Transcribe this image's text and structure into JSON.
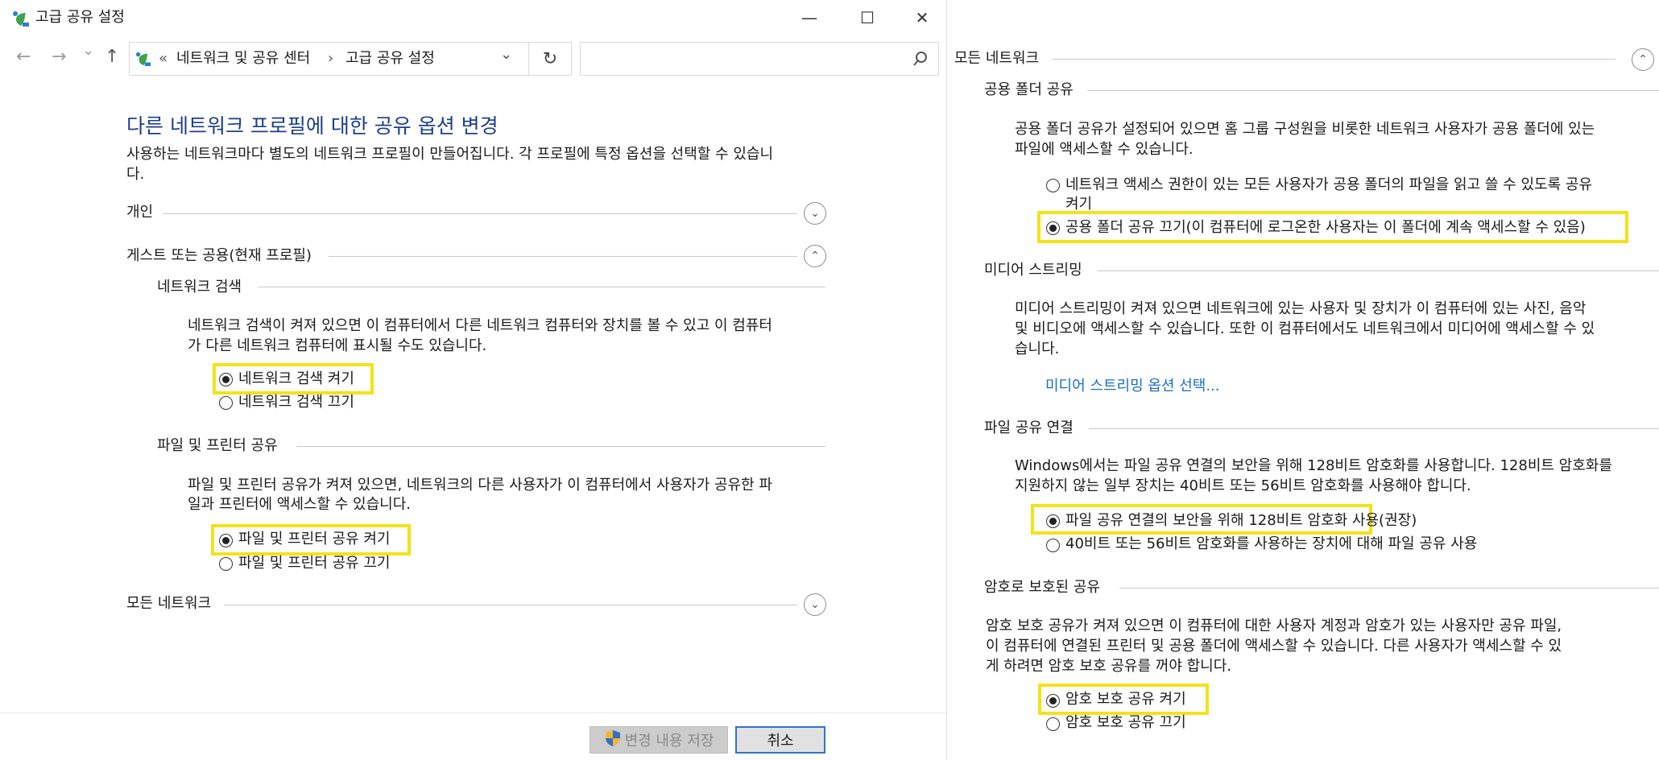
{
  "window": {
    "title": "고급 공유 설정",
    "minimize_glyph": "—",
    "maximize_glyph": "☐",
    "close_glyph": "✕"
  },
  "nav": {
    "back_glyph": "←",
    "forward_glyph": "→",
    "dropdown_glyph": "⌄",
    "up_glyph": "↑"
  },
  "address": {
    "prefix": "«",
    "crumb1": "네트워크 및 공유 센터",
    "separator": "›",
    "crumb2": "고급 공유 설정",
    "dropdown_glyph": "⌄",
    "refresh_glyph": "↻",
    "search_value": "",
    "search_icon": "🔍"
  },
  "left": {
    "heading": "다른 네트워크 프로필에 대한 공유 옵션 변경",
    "intro_line1": "사용하는 네트워크마다 별도의 네트워크 프로필이 만들어집니다. 각 프로필에 특정 옵션을 선택할 수 있습니",
    "intro_line2": "다.",
    "private_label": "개인",
    "guest_label": "게스트 또는 공용(현재 프로필)",
    "netdisc": {
      "title": "네트워크 검색",
      "desc1": "네트워크 검색이 켜져 있으면 이 컴퓨터에서 다른 네트워크 컴퓨터와 장치를 볼 수 있고 이 컴퓨터",
      "desc2": "가 다른 네트워크 컴퓨터에 표시될 수도 있습니다.",
      "on": "네트워크 검색 켜기",
      "off": "네트워크 검색 끄기"
    },
    "fps": {
      "title": "파일 및 프린터 공유",
      "desc1": "파일 및 프린터 공유가 켜져 있으면, 네트워크의 다른 사용자가 이 컴퓨터에서 사용자가 공유한 파",
      "desc2": "일과 프린터에 액세스할 수 있습니다.",
      "on": "파일 및 프린터 공유 켜기",
      "off": "파일 및 프린터 공유 끄기"
    },
    "all_networks_label": "모든 네트워크"
  },
  "buttons": {
    "save": "변경 내용 저장",
    "cancel": "취소"
  },
  "right": {
    "all_networks_label": "모든 네트워크",
    "public_folder": {
      "title": "공용 폴더 공유",
      "desc1": "공용 폴더 공유가 설정되어 있으면 홈 그룹 구성원을 비롯한 네트워크 사용자가 공용 폴더에 있는",
      "desc2": "파일에 액세스할 수 있습니다.",
      "on_line1": "네트워크 액세스 권한이 있는 모든 사용자가 공용 폴더의 파일을 읽고 쓸 수 있도록 공유",
      "on_line2": "켜기",
      "off": "공용 폴더 공유 끄기(이 컴퓨터에 로그온한 사용자는 이 폴더에 계속 액세스할 수 있음)"
    },
    "media": {
      "title": "미디어 스트리밍",
      "desc1": "미디어 스트리밍이 켜져 있으면 네트워크에 있는 사용자 및 장치가 이 컴퓨터에 있는 사진, 음악",
      "desc2": "및 비디오에 액세스할 수 있습니다. 또한 이 컴퓨터에서도 네트워크에서 미디어에 액세스할 수 있",
      "desc3": "습니다.",
      "link": "미디어 스트리밍 옵션 선택..."
    },
    "conn": {
      "title": "파일 공유 연결",
      "desc1": "Windows에서는 파일 공유 연결의 보안을 위해 128비트 암호화를 사용합니다. 128비트 암호화를",
      "desc2": "지원하지 않는 일부 장치는 40비트 또는 56비트 암호화를 사용해야 합니다.",
      "opt128": "파일 공유 연결의 보안을 위해 128비트 암호화 사용(권장)",
      "opt40": "40비트 또는 56비트 암호화를 사용하는 장치에 대해 파일 공유 사용"
    },
    "pw": {
      "title": "암호로 보호된 공유",
      "desc1": "암호 보호 공유가 켜져 있으면 이 컴퓨터에 대한 사용자 계정과 암호가 있는 사용자만 공유 파일,",
      "desc2": "이 컴퓨터에 연결된 프린터 및 공용 폴더에 액세스할 수 있습니다. 다른 사용자가 액세스할 수 있",
      "desc3": "게 하려면 암호 보호 공유를 꺼야 합니다.",
      "on": "암호 보호 공유 켜기",
      "off": "암호 보호 공유 끄기"
    }
  },
  "colors": {
    "heading": "#1e3f8c",
    "link": "#1a6fc4",
    "highlight": "#f4e21a"
  }
}
